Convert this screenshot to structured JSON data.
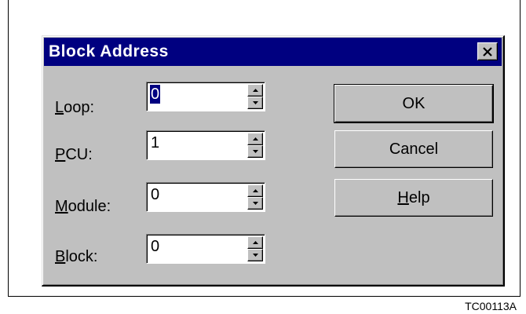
{
  "dialog": {
    "title": "Block Address",
    "fields": [
      {
        "key": "loop",
        "mnemonic": "L",
        "rest": "oop:",
        "value": "0",
        "selected": true
      },
      {
        "key": "pcu",
        "mnemonic": "P",
        "rest": "CU:",
        "value": "1",
        "selected": false
      },
      {
        "key": "module",
        "mnemonic": "M",
        "rest": "odule:",
        "value": "0",
        "selected": false
      },
      {
        "key": "block",
        "mnemonic": "B",
        "rest": "lock:",
        "value": "0",
        "selected": false
      }
    ],
    "buttons": {
      "ok": {
        "label": "OK"
      },
      "cancel": {
        "label": "Cancel"
      },
      "help": {
        "mnemonic": "H",
        "rest": "elp"
      }
    }
  },
  "caption": "TC00113A",
  "colors": {
    "titlebar": "#000080",
    "dialog_face": "#c0c0c0",
    "selection": "#000080"
  }
}
